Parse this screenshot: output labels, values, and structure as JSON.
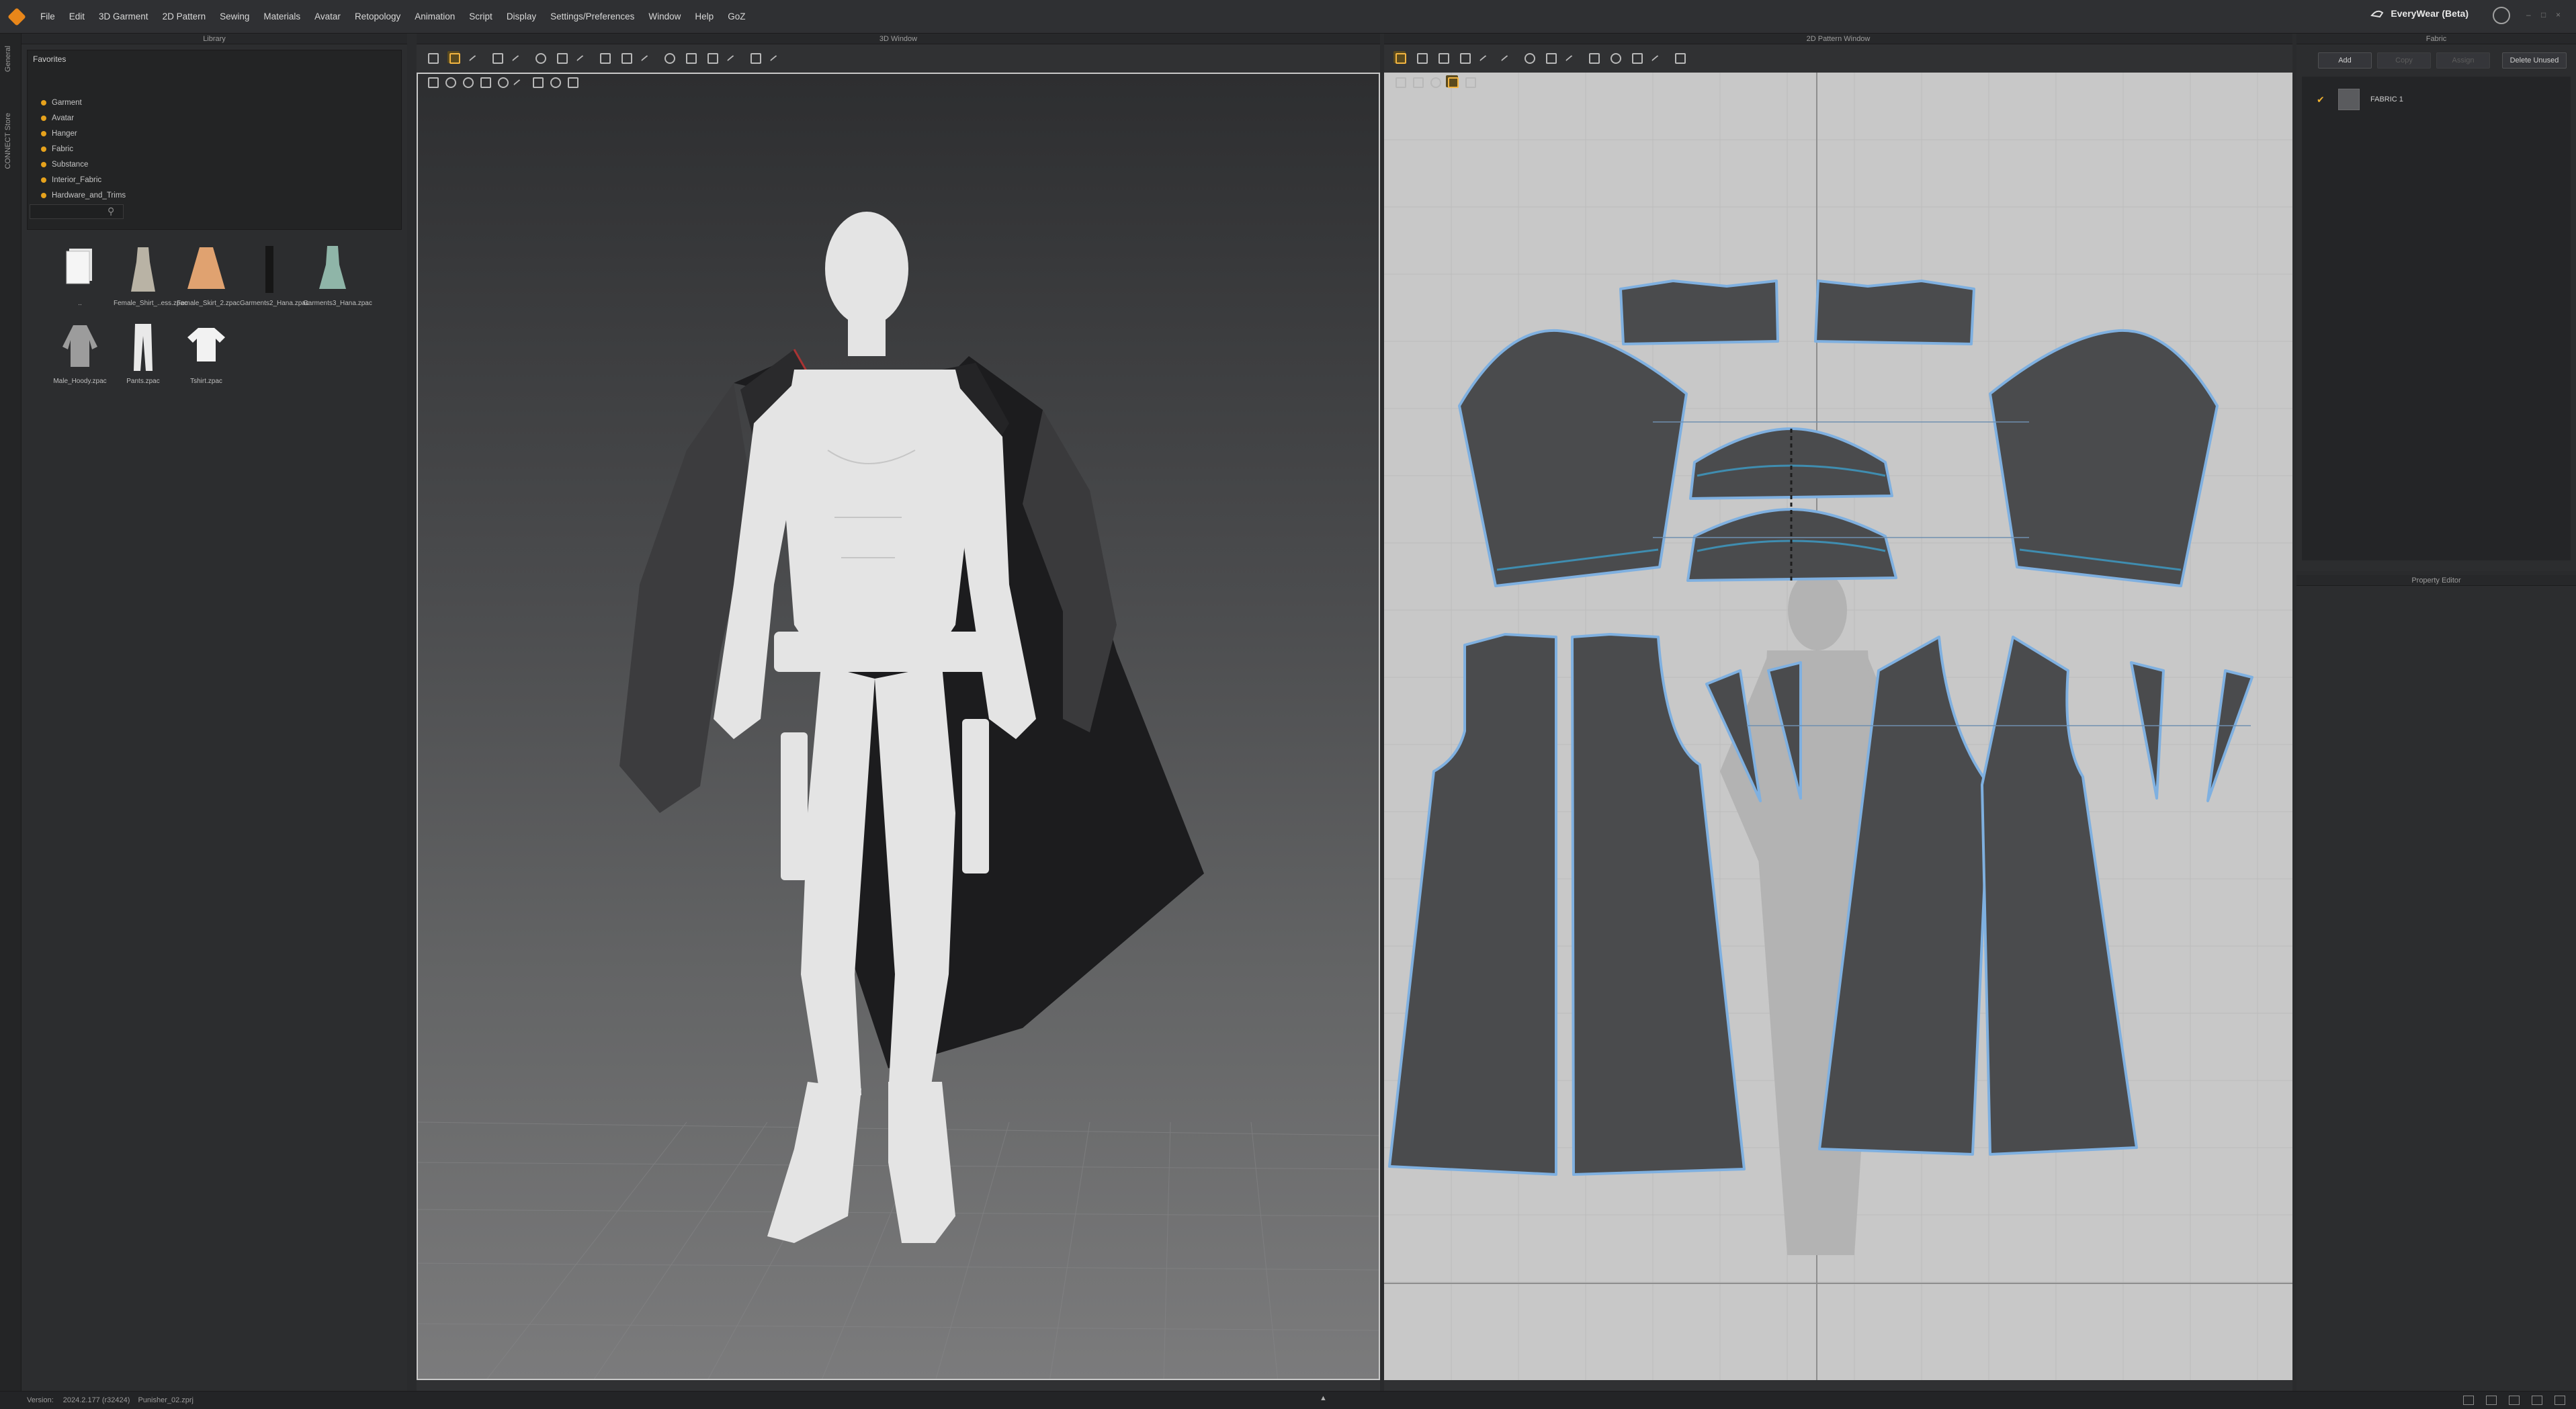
{
  "menubar": {
    "items": [
      "File",
      "Edit",
      "3D Garment",
      "2D Pattern",
      "Sewing",
      "Materials",
      "Avatar",
      "Retopology",
      "Animation",
      "Script",
      "Display",
      "Settings/Preferences",
      "Window",
      "Help",
      "GoZ"
    ],
    "brand": "EveryWear (Beta)"
  },
  "vtabs": [
    "General",
    "CONNECT Store"
  ],
  "library": {
    "title": "Library",
    "favorites_title": "Favorites",
    "folders": [
      "Garment",
      "Avatar",
      "Hanger",
      "Fabric",
      "Substance",
      "Interior_Fabric",
      "Hardware_and_Trims"
    ],
    "items": [
      {
        "label": "..",
        "kind": "folder"
      },
      {
        "label": "Female_Shirt_..ess.zpac",
        "kind": "dress"
      },
      {
        "label": "Female_Skirt_2.zpac",
        "kind": "skirt"
      },
      {
        "label": "Garments2_Hana.zpac",
        "kind": "dark"
      },
      {
        "label": "Garments3_Hana.zpac",
        "kind": "teal"
      },
      {
        "label": "Male_Hoody.zpac",
        "kind": "hoody"
      },
      {
        "label": "Pants.zpac",
        "kind": "pants"
      },
      {
        "label": "Tshirt.zpac",
        "kind": "tshirt"
      }
    ]
  },
  "view3d": {
    "title": "3D Window"
  },
  "view2d": {
    "title": "2D Pattern Window"
  },
  "fabric": {
    "title": "Fabric",
    "buttons": {
      "add": "Add",
      "copy": "Copy",
      "assign": "Assign",
      "delete_unused": "Delete Unused"
    },
    "items": [
      {
        "name": "FABRIC 1",
        "checked": true
      }
    ]
  },
  "property_editor": {
    "title": "Property Editor"
  },
  "status": {
    "version_label": "Version:",
    "version": "2024.2.177 (r32424)",
    "file": "Punisher_02.zprj"
  },
  "colors": {
    "accent": "#e6a21c",
    "pattern_fill": "#4a4b4d",
    "pattern_outline": "#7fb0e0"
  }
}
